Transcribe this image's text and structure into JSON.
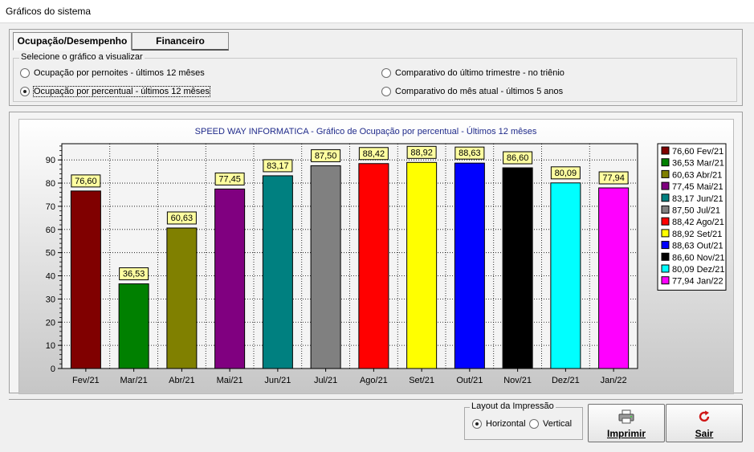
{
  "window": {
    "title": "Gráficos do sistema"
  },
  "tabs": [
    {
      "label": "Ocupação/Desempenho",
      "active": true
    },
    {
      "label": "Financeiro",
      "active": false
    }
  ],
  "chart_selector": {
    "legend": "Selecione o gráfico a visualizar",
    "options": [
      {
        "label": "Ocupação por pernoites - últimos 12 mêses",
        "checked": false
      },
      {
        "label": "Ocupação por percentual - últimos 12 mêses",
        "checked": true
      },
      {
        "label": "Comparativo do último trimestre - no triênio",
        "checked": false
      },
      {
        "label": "Comparativo do mês atual - últimos 5 anos",
        "checked": false
      }
    ]
  },
  "print_layout": {
    "legend": "Layout da Impressão",
    "options": [
      {
        "label": "Horizontal",
        "checked": true
      },
      {
        "label": "Vertical",
        "checked": false
      }
    ]
  },
  "buttons": {
    "print": {
      "label": "Imprimir",
      "icon": "printer-icon"
    },
    "exit": {
      "label": "Sair",
      "icon": "refresh-exit-icon",
      "icon_color": "#d01818"
    }
  },
  "chart_data": {
    "type": "bar",
    "title": "SPEED WAY INFORMATICA - Gráfico de Ocupação por percentual - Últimos 12 mêses",
    "categories": [
      "Fev/21",
      "Mar/21",
      "Abr/21",
      "Mai/21",
      "Jun/21",
      "Jul/21",
      "Ago/21",
      "Set/21",
      "Out/21",
      "Nov/21",
      "Dez/21",
      "Jan/22"
    ],
    "values": [
      76.6,
      36.53,
      60.63,
      77.45,
      83.17,
      87.5,
      88.42,
      88.92,
      88.63,
      86.6,
      80.09,
      77.94
    ],
    "value_labels": [
      "76,60",
      "36,53",
      "60,63",
      "77,45",
      "83,17",
      "87,50",
      "88,42",
      "88,92",
      "88,63",
      "86,60",
      "80,09",
      "77,94"
    ],
    "legend_entries": [
      "76,60 Fev/21",
      "36,53 Mar/21",
      "60,63 Abr/21",
      "77,45 Mai/21",
      "83,17 Jun/21",
      "87,50 Jul/21",
      "88,42 Ago/21",
      "88,92 Set/21",
      "88,63 Out/21",
      "86,60 Nov/21",
      "80,09 Dez/21",
      "77,94 Jan/22"
    ],
    "colors": [
      "#800000",
      "#008000",
      "#808000",
      "#800080",
      "#008080",
      "#808080",
      "#ff0000",
      "#ffff00",
      "#0000ff",
      "#000000",
      "#00ffff",
      "#ff00ff"
    ],
    "ylim": [
      0,
      97
    ],
    "yticks": [
      0,
      10,
      20,
      30,
      40,
      50,
      60,
      70,
      80,
      90
    ],
    "xlabel": "",
    "ylabel": "",
    "grid": true,
    "legend_position": "right"
  }
}
